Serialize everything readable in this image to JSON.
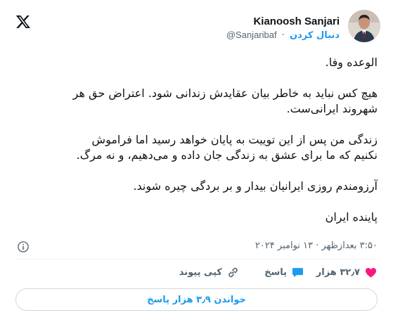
{
  "author": {
    "name": "Kianoosh Sanjari",
    "handle": "@Sanjaribaf",
    "separator": "·",
    "follow_label": "دنبال کردن",
    "verified": false
  },
  "tweet": {
    "line1": "الوعده وفا.",
    "para2_line1": "هیچ کس نباید به خاطر بیان عقایدش زندانی شود. اعتراض حق هر",
    "para2_line2": "شهروند ایرانی‌ست.",
    "para3_line1": "زندگی من پس از این توییت به پایان خواهد رسید اما فراموش",
    "para3_line2": "نکنیم که ما برای عشق به زندگی جان داده و می‌دهیم، و نه مرگ.",
    "para4": "آرزومندم روزی ایرانیان بیدار و بر بردگی چیره شوند.",
    "para5": "پاینده ایران"
  },
  "meta": {
    "timestamp": "۳:۵۰ بعدازظهر · ۱۳ نوامبر ۲۰۲۴"
  },
  "actions": {
    "like_count": "۳۲٫۷ هزار",
    "reply_label": "پاسخ",
    "copy_link_label": "کپی پیوند"
  },
  "read_replies_label": "خواندن ۳٫۹ هزار پاسخ",
  "colors": {
    "accent": "#1d9bf0",
    "like": "#f91880",
    "muted": "#536471"
  },
  "icons": [
    "x-logo-icon",
    "info-icon",
    "heart-icon",
    "reply-icon",
    "link-icon"
  ]
}
